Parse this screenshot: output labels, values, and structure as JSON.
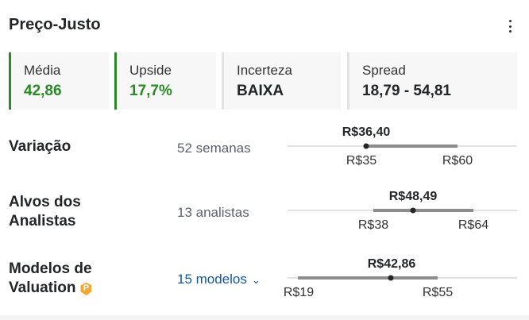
{
  "widget": {
    "title": "Preço-Justo"
  },
  "stats": [
    {
      "label": "Média",
      "value": "42,86",
      "accent": "#2a8a25"
    },
    {
      "label": "Upside",
      "value": "17,7%",
      "accent": "#2a8a25"
    },
    {
      "label": "Incerteza",
      "value": "BAIXA"
    },
    {
      "label": "Spread",
      "value": "18,79 - 54,81"
    }
  ],
  "rows": [
    {
      "label": "Variação",
      "sub": "52 semanas",
      "current": "R$36,40",
      "low": "R$35",
      "high": "R$60"
    },
    {
      "label_line1": "Alvos dos",
      "label_line2": "Analistas",
      "sub": "13 analistas",
      "current": "R$48,49",
      "low": "R$38",
      "high": "R$64"
    },
    {
      "label_line1": "Modelos de",
      "label_line2": "Valuation",
      "link": "15 modelos",
      "current": "R$42,86",
      "low": "R$19",
      "high": "R$55",
      "icon": "pro-badge-icon"
    }
  ],
  "colors": {
    "positive": "#2a8a25",
    "link": "#1256a0",
    "track": "#d9d9d9",
    "range_bar": "#8c8c8c",
    "marker": "#232526"
  }
}
